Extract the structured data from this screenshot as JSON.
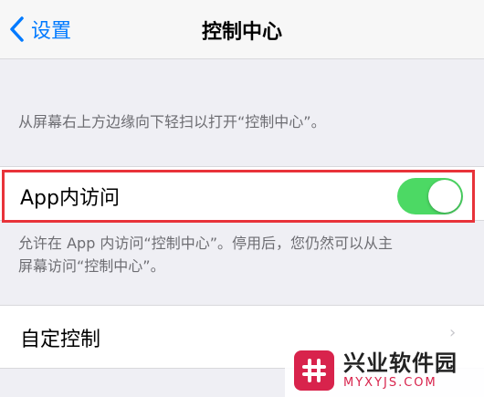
{
  "nav": {
    "back_label": "设置",
    "title": "控制中心"
  },
  "intro_text": "从屏幕右上方边缘向下轻扫以打开“控制中心”。",
  "app_access": {
    "label": "App内访问",
    "enabled": true,
    "description_line1": "允许在 App 内访问“控制中心”。停用后，您仍然可以从主",
    "description_line2": "屏幕访问“控制中心”。"
  },
  "customize": {
    "label": "自定控制"
  },
  "watermark": {
    "name": "兴业软件园",
    "site": "MYXYJS.COM"
  },
  "colors": {
    "accent": "#007aff",
    "toggle_on": "#4cd964",
    "highlight": "#e8333a",
    "watermark": "#d8234c"
  }
}
